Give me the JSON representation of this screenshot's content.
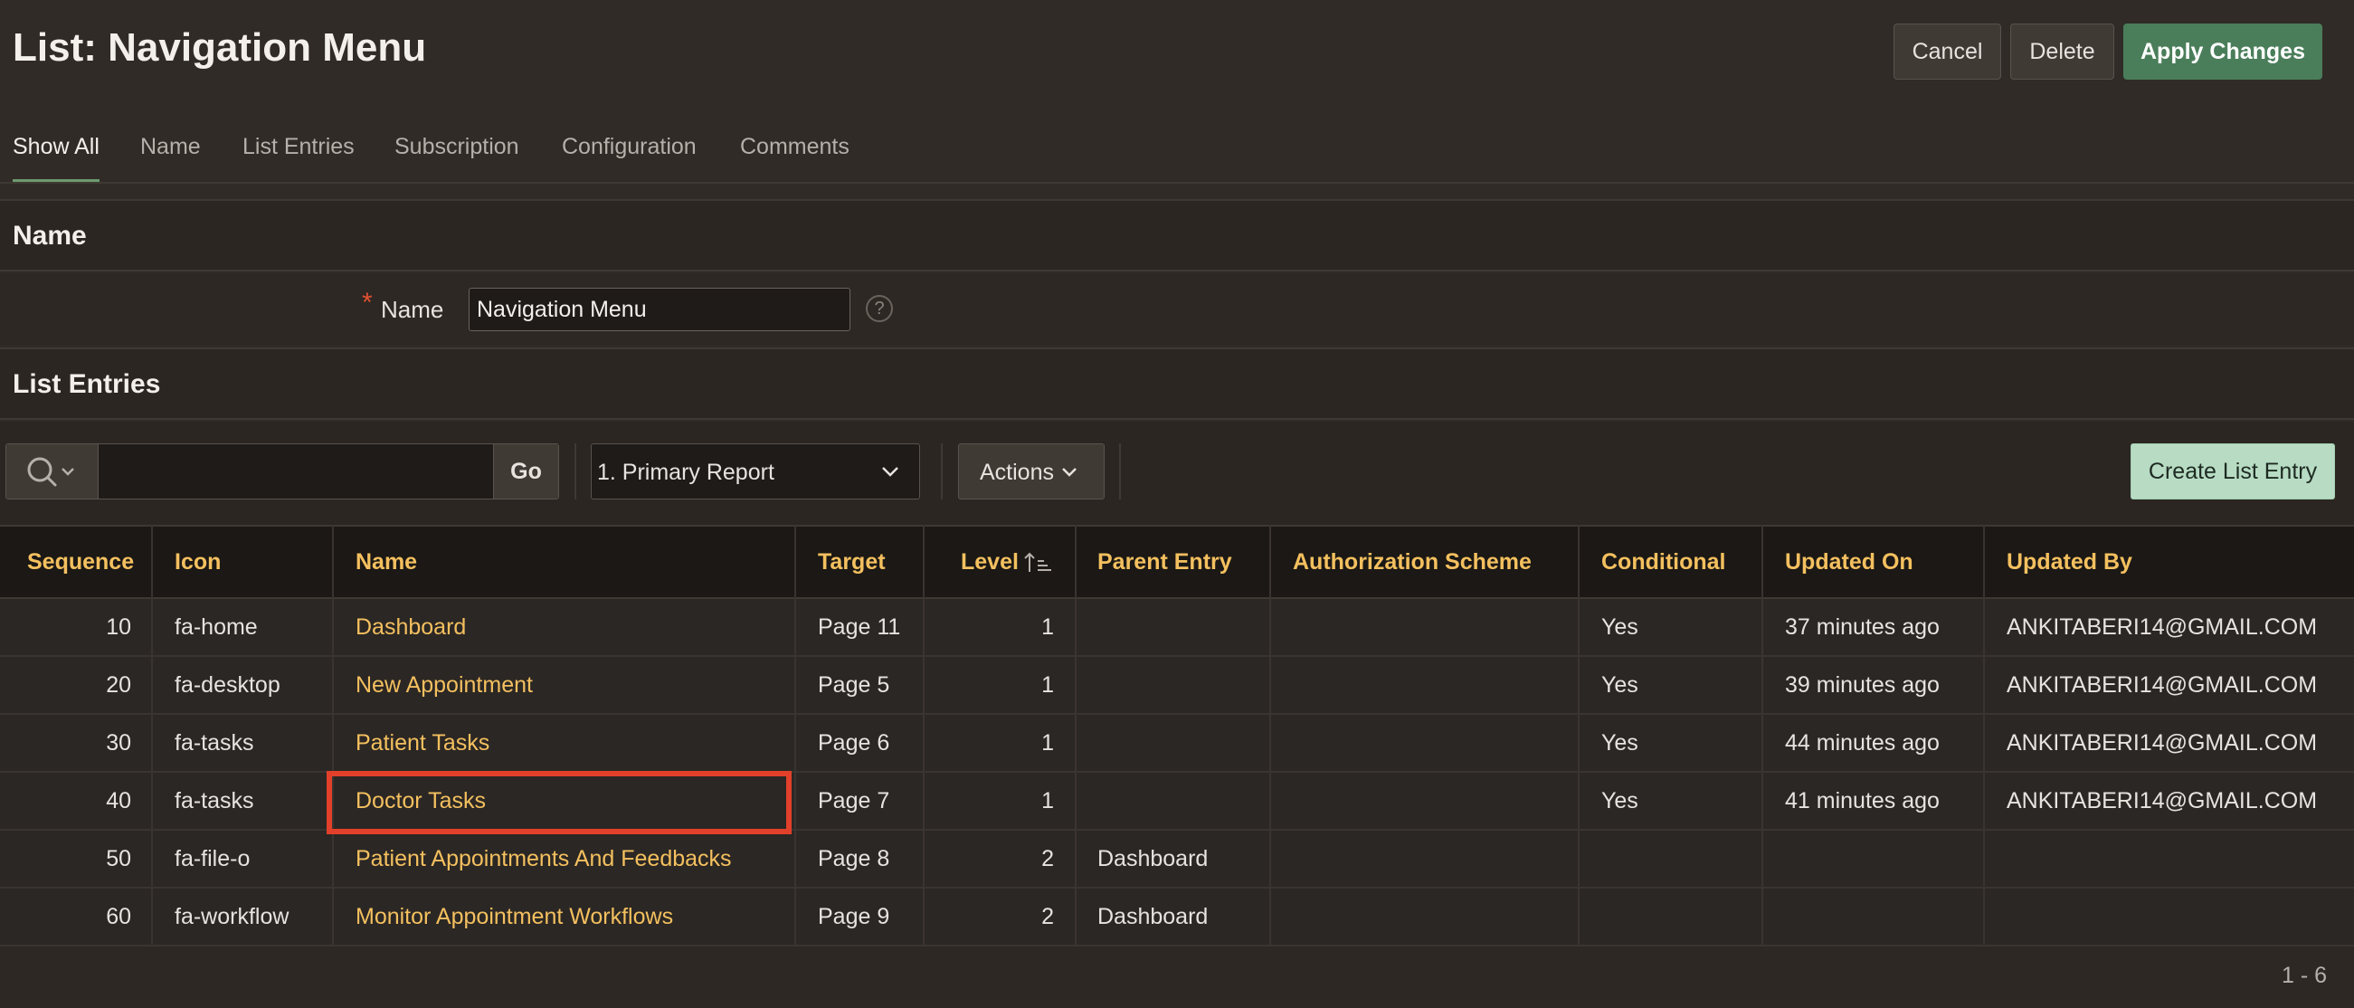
{
  "page": {
    "title": "List: Navigation Menu"
  },
  "buttons": {
    "cancel": "Cancel",
    "delete": "Delete",
    "apply": "Apply Changes"
  },
  "tabs": [
    {
      "label": "Show All",
      "active": true
    },
    {
      "label": "Name"
    },
    {
      "label": "List Entries"
    },
    {
      "label": "Subscription"
    },
    {
      "label": "Configuration"
    },
    {
      "label": "Comments"
    }
  ],
  "name_region": {
    "title": "Name",
    "required_mark": "*",
    "field_label": "Name",
    "field_value": "Navigation Menu",
    "help_glyph": "?"
  },
  "list_entries": {
    "title": "List Entries",
    "search": {
      "icon": "search-icon",
      "value": "",
      "go_label": "Go"
    },
    "report_select": "1. Primary Report",
    "actions_label": "Actions",
    "create_label": "Create List Entry",
    "columns": [
      "Sequence",
      "Icon",
      "Name",
      "Target",
      "Level",
      "Parent Entry",
      "Authorization Scheme",
      "Conditional",
      "Updated On",
      "Updated By"
    ],
    "sorted_column": "Level",
    "rows": [
      {
        "sequence": "10",
        "icon": "fa-home",
        "name": "Dashboard",
        "target": "Page 11",
        "level": "1",
        "parent": "",
        "auth": "",
        "conditional": "Yes",
        "updated_on": "37 minutes ago",
        "updated_by": "ANKITABERI14@GMAIL.COM"
      },
      {
        "sequence": "20",
        "icon": "fa-desktop",
        "name": "New Appointment",
        "target": "Page 5",
        "level": "1",
        "parent": "",
        "auth": "",
        "conditional": "Yes",
        "updated_on": "39 minutes ago",
        "updated_by": "ANKITABERI14@GMAIL.COM"
      },
      {
        "sequence": "30",
        "icon": "fa-tasks",
        "name": "Patient Tasks",
        "target": "Page 6",
        "level": "1",
        "parent": "",
        "auth": "",
        "conditional": "Yes",
        "updated_on": "44 minutes ago",
        "updated_by": "ANKITABERI14@GMAIL.COM"
      },
      {
        "sequence": "40",
        "icon": "fa-tasks",
        "name": "Doctor Tasks",
        "target": "Page 7",
        "level": "1",
        "parent": "",
        "auth": "",
        "conditional": "Yes",
        "updated_on": "41 minutes ago",
        "updated_by": "ANKITABERI14@GMAIL.COM"
      },
      {
        "sequence": "50",
        "icon": "fa-file-o",
        "name": "Patient Appointments And Feedbacks",
        "target": "Page 8",
        "level": "2",
        "parent": "Dashboard",
        "auth": "",
        "conditional": "",
        "updated_on": "",
        "updated_by": ""
      },
      {
        "sequence": "60",
        "icon": "fa-workflow",
        "name": "Monitor Appointment Workflows",
        "target": "Page 9",
        "level": "2",
        "parent": "Dashboard",
        "auth": "",
        "conditional": "",
        "updated_on": "",
        "updated_by": ""
      }
    ],
    "pagination": "1 - 6"
  },
  "colors": {
    "accent_link": "#f4c05f",
    "apply_button": "#4a7e5a",
    "highlight": "#e2402a",
    "create_button": "#b7dcc3"
  }
}
